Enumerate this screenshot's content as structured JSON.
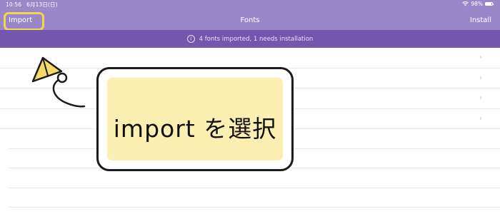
{
  "status_bar": {
    "time": "10:56",
    "date": "6月13日(日)",
    "battery": "98%"
  },
  "nav": {
    "import_label": "Import",
    "title": "Fonts",
    "install_label": "Install"
  },
  "banner": {
    "text": "4 fonts imported, 1 needs installation"
  },
  "list": {
    "chevron": "›"
  },
  "callout": {
    "text": "import を選択"
  },
  "colors": {
    "header": "#9a87c9",
    "banner": "#7257ad",
    "highlight": "#f1d64e",
    "callout_fill": "#fbefb1"
  },
  "icons": [
    "wifi-icon",
    "battery-icon",
    "info-icon",
    "chevron-right-icon",
    "kite-pointer-icon"
  ]
}
